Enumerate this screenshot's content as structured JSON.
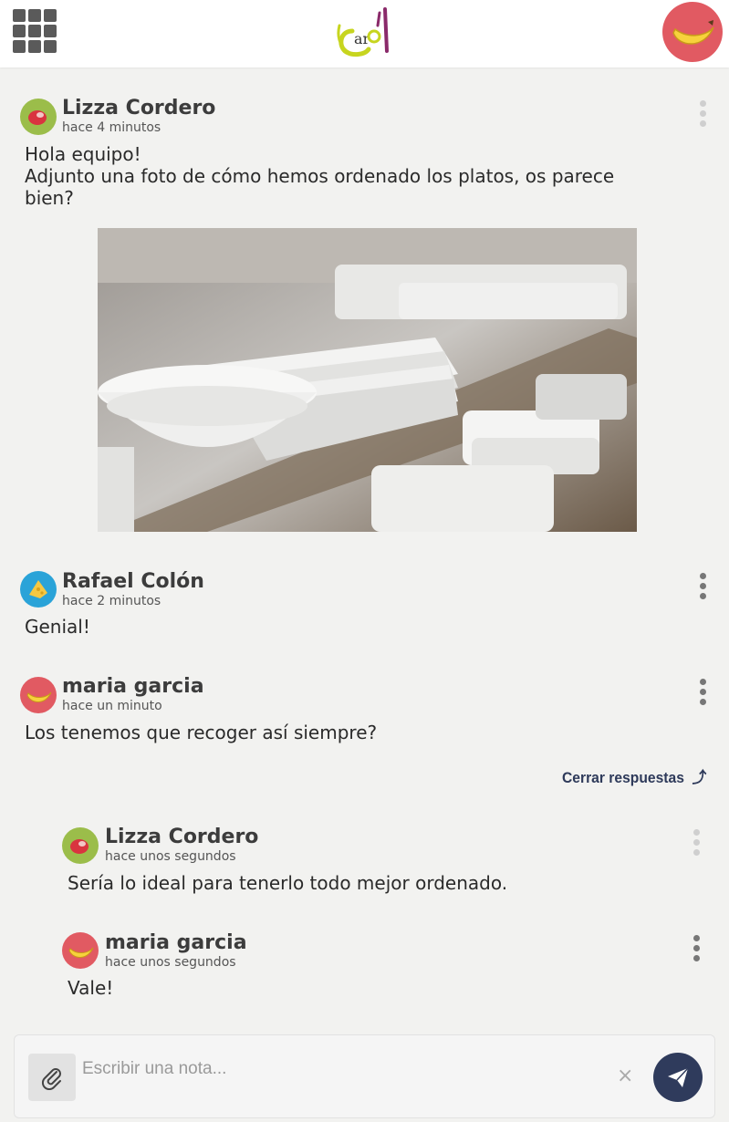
{
  "header": {
    "logo_text": "Carol",
    "apps_icon": "grid-icon",
    "avatar_icon": "banana-icon"
  },
  "feed": {
    "post1": {
      "author": "Lizza Cordero",
      "time": "hace 4 minutos",
      "lines": [
        "Hola equipo!",
        "Adjunto una foto de cómo hemos ordenado los platos, os parece",
        "bien?"
      ],
      "avatar_icon": "steak-icon",
      "image_icon": "dishes-photo"
    },
    "post2": {
      "author": "Rafael Colón",
      "time": "hace 2 minutos",
      "text": "Genial!",
      "avatar_icon": "cheese-icon"
    },
    "post3": {
      "author": "maria garcia",
      "time": "hace un minuto",
      "text": "Los tenemos que recoger así siempre?",
      "avatar_icon": "banana-icon",
      "close_replies_label": "Cerrar respuestas",
      "close_replies_icon": "arrow-up-icon",
      "replies": [
        {
          "author": "Lizza Cordero",
          "time": "hace unos segundos",
          "text": "Sería lo ideal para tenerlo todo mejor ordenado.",
          "avatar_icon": "steak-icon"
        },
        {
          "author": "maria garcia",
          "time": "hace unos segundos",
          "text": "Vale!",
          "avatar_icon": "banana-icon"
        }
      ]
    }
  },
  "composer": {
    "placeholder": "Escribir una nota...",
    "attach_icon": "paperclip-icon",
    "clear_label": "×",
    "send_icon": "paper-plane-icon"
  },
  "colors": {
    "accent_dark": "#2f3b5c",
    "avatar_red": "#e15a62",
    "avatar_green": "#9bbd4a",
    "avatar_blue": "#2aa3d8"
  }
}
